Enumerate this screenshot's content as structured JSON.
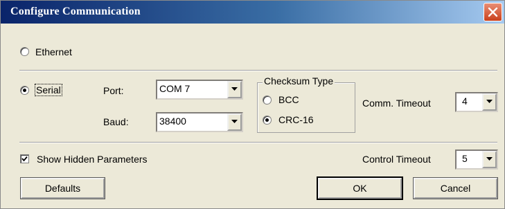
{
  "window": {
    "title": "Configure Communication"
  },
  "connection": {
    "ethernet_label": "Ethernet",
    "serial_label": "Serial",
    "selected": "Serial"
  },
  "serial": {
    "port_label": "Port:",
    "port_value": "COM 7",
    "baud_label": "Baud:",
    "baud_value": "38400"
  },
  "checksum": {
    "legend": "Checksum Type",
    "options": [
      "BCC",
      "CRC-16"
    ],
    "selected": "CRC-16"
  },
  "comm_timeout": {
    "label": "Comm. Timeout",
    "value": "4"
  },
  "hidden_params": {
    "label": "Show Hidden Parameters",
    "checked": true
  },
  "control_timeout": {
    "label": "Control Timeout",
    "value": "5"
  },
  "buttons": {
    "defaults": "Defaults",
    "ok": "OK",
    "cancel": "Cancel"
  },
  "colors": {
    "title_start": "#0a246a",
    "title_end": "#a6caf0",
    "dialog_bg": "#ece9d8",
    "close_red": "#c9401c"
  }
}
